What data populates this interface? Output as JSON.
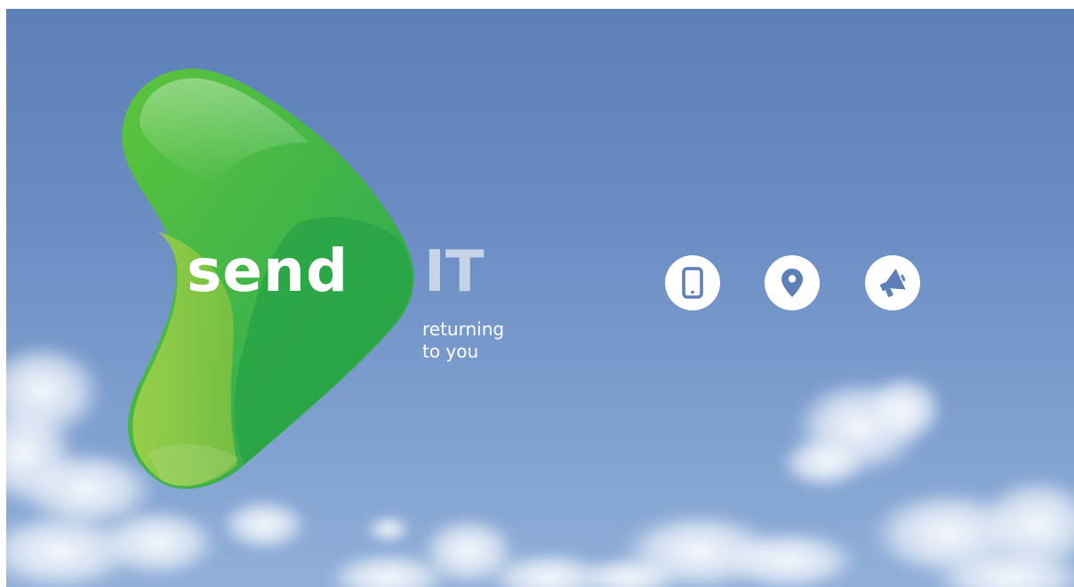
{
  "brand": {
    "logo_word": "send",
    "logo_suffix": "IT",
    "tagline_line1": "returning",
    "tagline_line2": "to you",
    "accent_green": "#3fb34a",
    "light_green": "#8cc63f",
    "sky_color": "#6a8cc2"
  },
  "actions": [
    {
      "icon": "mobile-phone-icon"
    },
    {
      "icon": "map-pin-icon"
    },
    {
      "icon": "megaphone-icon"
    }
  ]
}
